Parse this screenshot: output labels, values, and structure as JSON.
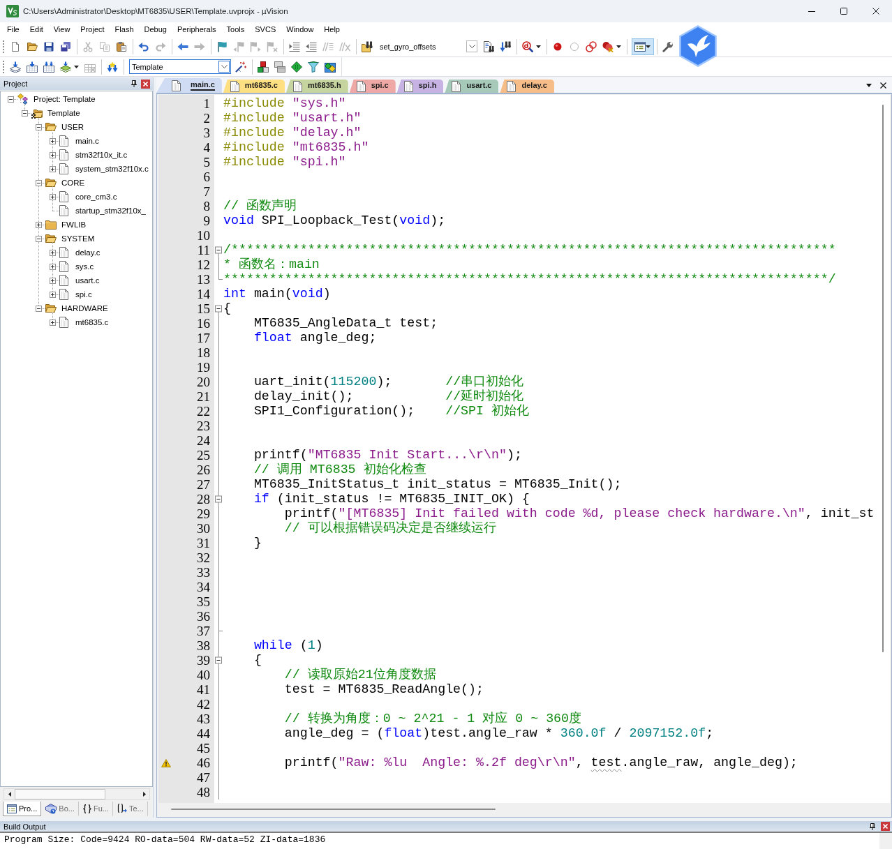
{
  "window": {
    "title": "C:\\Users\\Administrator\\Desktop\\MT6835\\USER\\Template.uvprojx - µVision"
  },
  "menu": [
    "File",
    "Edit",
    "View",
    "Project",
    "Flash",
    "Debug",
    "Peripherals",
    "Tools",
    "SVCS",
    "Window",
    "Help"
  ],
  "toolbar_top": [
    {
      "kind": "new",
      "disabled": false
    },
    {
      "kind": "open",
      "disabled": false
    },
    {
      "kind": "save",
      "disabled": false
    },
    {
      "kind": "saveall",
      "disabled": false
    },
    {
      "kind": "separator"
    },
    {
      "kind": "cut",
      "disabled": true
    },
    {
      "kind": "copy",
      "disabled": true
    },
    {
      "kind": "paste",
      "disabled": false
    },
    {
      "kind": "separator"
    },
    {
      "kind": "undo",
      "disabled": false
    },
    {
      "kind": "redo",
      "disabled": true
    },
    {
      "kind": "separator"
    },
    {
      "kind": "back",
      "disabled": false
    },
    {
      "kind": "forward",
      "disabled": true
    },
    {
      "kind": "separator"
    },
    {
      "kind": "bookmark",
      "disabled": false
    },
    {
      "kind": "prevmark",
      "disabled": true
    },
    {
      "kind": "nextmark",
      "disabled": true
    },
    {
      "kind": "clearmarks",
      "disabled": true
    },
    {
      "kind": "separator"
    },
    {
      "kind": "indent",
      "disabled": false
    },
    {
      "kind": "outdent",
      "disabled": false
    },
    {
      "kind": "comment",
      "disabled": true
    },
    {
      "kind": "uncomment",
      "disabled": true
    },
    {
      "kind": "separator"
    },
    {
      "kind": "findfiles",
      "disabled": false
    },
    {
      "kind": "findcombo",
      "value": "set_gyro_offsets"
    },
    {
      "kind": "find",
      "disabled": false
    },
    {
      "kind": "incfind",
      "disabled": false
    },
    {
      "kind": "separator"
    },
    {
      "kind": "debug",
      "disabled": false,
      "dropdown": true
    },
    {
      "kind": "separator"
    },
    {
      "kind": "breakpoint",
      "disabled": false
    },
    {
      "kind": "enablebp",
      "disabled": true
    },
    {
      "kind": "disablebps",
      "disabled": false
    },
    {
      "kind": "killbps",
      "disabled": false,
      "dropdown": true
    },
    {
      "kind": "separator"
    },
    {
      "kind": "windows",
      "disabled": false,
      "dropdown": true,
      "pressed": true
    },
    {
      "kind": "separator"
    },
    {
      "kind": "configure",
      "disabled": false
    }
  ],
  "toolbar_build": [
    {
      "kind": "translate",
      "disabled": false
    },
    {
      "kind": "build",
      "disabled": false
    },
    {
      "kind": "rebuild",
      "disabled": false
    },
    {
      "kind": "batch",
      "disabled": false,
      "dropdown": true
    },
    {
      "kind": "stop",
      "disabled": true
    },
    {
      "kind": "separator"
    },
    {
      "kind": "download",
      "disabled": false
    },
    {
      "kind": "separator"
    },
    {
      "kind": "targetcombo",
      "value": "Template"
    },
    {
      "kind": "options",
      "disabled": false
    },
    {
      "kind": "separator"
    },
    {
      "kind": "components",
      "disabled": false
    },
    {
      "kind": "environment",
      "disabled": false
    },
    {
      "kind": "packs",
      "disabled": false
    },
    {
      "kind": "selectpacks",
      "disabled": false
    },
    {
      "kind": "installer",
      "disabled": false
    }
  ],
  "project_panel": {
    "title": "Project",
    "tree": [
      {
        "kind": "project",
        "label": "Project: Template",
        "expanded": true,
        "children": [
          {
            "kind": "target",
            "label": "Template",
            "expanded": true,
            "children": [
              {
                "kind": "folder",
                "label": "USER",
                "expanded": true,
                "children": [
                  {
                    "kind": "file",
                    "label": "main.c",
                    "expanded": false
                  },
                  {
                    "kind": "file",
                    "label": "stm32f10x_it.c",
                    "expanded": false
                  },
                  {
                    "kind": "file",
                    "label": "system_stm32f10x.c",
                    "expanded": false
                  }
                ]
              },
              {
                "kind": "folder",
                "label": "CORE",
                "expanded": true,
                "children": [
                  {
                    "kind": "file",
                    "label": "core_cm3.c",
                    "expanded": false
                  },
                  {
                    "kind": "file",
                    "label": "startup_stm32f10x_"
                  }
                ]
              },
              {
                "kind": "folder",
                "label": "FWLIB",
                "expanded": false
              },
              {
                "kind": "folder",
                "label": "SYSTEM",
                "expanded": true,
                "children": [
                  {
                    "kind": "file",
                    "label": "delay.c",
                    "expanded": false
                  },
                  {
                    "kind": "file",
                    "label": "sys.c",
                    "expanded": false
                  },
                  {
                    "kind": "file",
                    "label": "usart.c",
                    "expanded": false
                  },
                  {
                    "kind": "file",
                    "label": "spi.c",
                    "expanded": false
                  }
                ]
              },
              {
                "kind": "folder",
                "label": "HARDWARE",
                "expanded": true,
                "children": [
                  {
                    "kind": "file",
                    "label": "mt6835.c",
                    "expanded": false
                  }
                ]
              }
            ]
          }
        ]
      }
    ],
    "tabs": [
      {
        "kind": "project",
        "label": "Pro...",
        "selected": true
      },
      {
        "kind": "books",
        "label": "Bo...",
        "selected": false
      },
      {
        "kind": "functions",
        "label": "Fu...",
        "selected": false
      },
      {
        "kind": "templates",
        "label": "Te...",
        "selected": false
      }
    ]
  },
  "editor": {
    "tabs": [
      {
        "label": "main.c",
        "color": "#cfdcf3",
        "selected": true
      },
      {
        "label": "mt6835.c",
        "color": "#fedf82",
        "selected": false
      },
      {
        "label": "mt6835.h",
        "color": "#c6d49f",
        "selected": false
      },
      {
        "label": "spi.c",
        "color": "#eea9a6",
        "selected": false
      },
      {
        "label": "spi.h",
        "color": "#c6b3e3",
        "selected": false
      },
      {
        "label": "usart.c",
        "color": "#a6c9ba",
        "selected": false
      },
      {
        "label": "delay.c",
        "color": "#f7bd88",
        "selected": false
      }
    ],
    "lines": [
      {
        "number": "1",
        "kind": "plain",
        "tokens": [
          {
            "kind": "preproc",
            "text": "#include "
          },
          {
            "kind": "string",
            "text": "\"sys.h\""
          }
        ]
      },
      {
        "number": "2",
        "kind": "plain",
        "tokens": [
          {
            "kind": "preproc",
            "text": "#include "
          },
          {
            "kind": "string",
            "text": "\"usart.h\""
          }
        ]
      },
      {
        "number": "3",
        "kind": "plain",
        "tokens": [
          {
            "kind": "preproc",
            "text": "#include "
          },
          {
            "kind": "string",
            "text": "\"delay.h\""
          }
        ]
      },
      {
        "number": "4",
        "kind": "plain",
        "tokens": [
          {
            "kind": "preproc",
            "text": "#include "
          },
          {
            "kind": "string",
            "text": "\"mt6835.h\""
          }
        ]
      },
      {
        "number": "5",
        "kind": "plain",
        "tokens": [
          {
            "kind": "preproc",
            "text": "#include "
          },
          {
            "kind": "string",
            "text": "\"spi.h\""
          }
        ]
      },
      {
        "number": "6",
        "kind": "plain"
      },
      {
        "number": "7",
        "kind": "plain"
      },
      {
        "number": "8",
        "kind": "plain",
        "tokens": [
          {
            "kind": "comment",
            "text": "// 函数声明"
          }
        ]
      },
      {
        "number": "9",
        "kind": "plain",
        "tokens": [
          {
            "kind": "keyword",
            "text": "void"
          },
          {
            "kind": "plain",
            "text": " SPI_Loopback_Test("
          },
          {
            "kind": "keyword",
            "text": "void"
          },
          {
            "kind": "plain",
            "text": ");"
          }
        ]
      },
      {
        "number": "10",
        "kind": "plain"
      },
      {
        "number": "11",
        "kind": "foldstart",
        "tokens": [
          {
            "kind": "comment",
            "text": "/*******************************************************************************"
          }
        ]
      },
      {
        "number": "12",
        "kind": "foldbody",
        "tokens": [
          {
            "kind": "comment",
            "text": "* 函数名：main"
          }
        ]
      },
      {
        "number": "13",
        "kind": "foldend",
        "tokens": [
          {
            "kind": "comment",
            "text": "*******************************************************************************/"
          }
        ]
      },
      {
        "number": "14",
        "kind": "plain",
        "tokens": [
          {
            "kind": "keyword",
            "text": "int"
          },
          {
            "kind": "plain",
            "text": " main("
          },
          {
            "kind": "keyword",
            "text": "void"
          },
          {
            "kind": "plain",
            "text": ")"
          }
        ]
      },
      {
        "number": "15",
        "kind": "foldstart",
        "tokens": [
          {
            "kind": "plain",
            "text": "{"
          }
        ]
      },
      {
        "number": "16",
        "kind": "foldbody",
        "tokens": [
          {
            "kind": "plain",
            "text": "    MT6835_AngleData_t test;"
          }
        ]
      },
      {
        "number": "17",
        "kind": "foldbody",
        "tokens": [
          {
            "kind": "keyword",
            "text": "    float"
          },
          {
            "kind": "plain",
            "text": " angle_deg;"
          }
        ]
      },
      {
        "number": "18",
        "kind": "foldbody"
      },
      {
        "number": "19",
        "kind": "foldbody"
      },
      {
        "number": "20",
        "kind": "foldbody",
        "tokens": [
          {
            "kind": "plain",
            "text": "    uart_init("
          },
          {
            "kind": "number",
            "text": "115200"
          },
          {
            "kind": "plain",
            "text": ");       "
          },
          {
            "kind": "comment",
            "text": "//串口初始化"
          }
        ]
      },
      {
        "number": "21",
        "kind": "foldbody",
        "tokens": [
          {
            "kind": "plain",
            "text": "    delay_init();            "
          },
          {
            "kind": "comment",
            "text": "//延时初始化"
          }
        ]
      },
      {
        "number": "22",
        "kind": "foldbody",
        "tokens": [
          {
            "kind": "plain",
            "text": "    SPI1_Configuration();    "
          },
          {
            "kind": "comment",
            "text": "//SPI 初始化"
          }
        ]
      },
      {
        "number": "23",
        "kind": "foldbody"
      },
      {
        "number": "24",
        "kind": "foldbody"
      },
      {
        "number": "25",
        "kind": "foldbody",
        "tokens": [
          {
            "kind": "plain",
            "text": "    printf("
          },
          {
            "kind": "string",
            "text": "\"MT6835 Init Start...\\r\\n\""
          },
          {
            "kind": "plain",
            "text": ");"
          }
        ]
      },
      {
        "number": "26",
        "kind": "foldbody",
        "tokens": [
          {
            "kind": "comment",
            "text": "    // 调用 MT6835 初始化检查"
          }
        ]
      },
      {
        "number": "27",
        "kind": "foldbody",
        "tokens": [
          {
            "kind": "plain",
            "text": "    MT6835_InitStatus_t init_status = MT6835_Init();"
          }
        ]
      },
      {
        "number": "28",
        "kind": "foldstart",
        "tokens": [
          {
            "kind": "keyword",
            "text": "    if"
          },
          {
            "kind": "plain",
            "text": " (init_status != MT6835_INIT_OK) {"
          }
        ]
      },
      {
        "number": "29",
        "kind": "foldbody",
        "tokens": [
          {
            "kind": "plain",
            "text": "        printf("
          },
          {
            "kind": "string",
            "text": "\"[MT6835] Init failed with code %d, please check hardware.\\n\""
          },
          {
            "kind": "plain",
            "text": ", init_st"
          }
        ]
      },
      {
        "number": "30",
        "kind": "foldbody",
        "tokens": [
          {
            "kind": "comment",
            "text": "        // 可以根据错误码决定是否继续运行"
          }
        ]
      },
      {
        "number": "31",
        "kind": "foldbody",
        "tokens": [
          {
            "kind": "plain",
            "text": "    }"
          }
        ]
      },
      {
        "number": "32",
        "kind": "foldbody"
      },
      {
        "number": "33",
        "kind": "foldbody"
      },
      {
        "number": "34",
        "kind": "foldbody"
      },
      {
        "number": "35",
        "kind": "foldbody"
      },
      {
        "number": "36",
        "kind": "foldbody"
      },
      {
        "number": "37",
        "kind": "foldend"
      },
      {
        "number": "38",
        "kind": "foldbody",
        "tokens": [
          {
            "kind": "keyword",
            "text": "    while"
          },
          {
            "kind": "plain",
            "text": " ("
          },
          {
            "kind": "number",
            "text": "1"
          },
          {
            "kind": "plain",
            "text": ")"
          }
        ]
      },
      {
        "number": "39",
        "kind": "foldstart",
        "tokens": [
          {
            "kind": "plain",
            "text": "    {"
          }
        ]
      },
      {
        "number": "40",
        "kind": "foldbody",
        "tokens": [
          {
            "kind": "comment",
            "text": "        // 读取原始21位角度数据"
          }
        ]
      },
      {
        "number": "41",
        "kind": "foldbody",
        "tokens": [
          {
            "kind": "plain",
            "text": "        test = MT6835_ReadAngle();"
          }
        ]
      },
      {
        "number": "42",
        "kind": "foldbody"
      },
      {
        "number": "43",
        "kind": "foldbody",
        "tokens": [
          {
            "kind": "comment",
            "text": "        // 转换为角度：0 ~ 2^21 - 1 对应 0 ~ 360度"
          }
        ]
      },
      {
        "number": "44",
        "kind": "foldbody",
        "tokens": [
          {
            "kind": "plain",
            "text": "        angle_deg = ("
          },
          {
            "kind": "keyword",
            "text": "float"
          },
          {
            "kind": "plain",
            "text": ")test.angle_raw * "
          },
          {
            "kind": "number",
            "text": "360.0f"
          },
          {
            "kind": "plain",
            "text": " / "
          },
          {
            "kind": "number",
            "text": "2097152.0f"
          },
          {
            "kind": "plain",
            "text": ";"
          }
        ]
      },
      {
        "number": "45",
        "kind": "foldbody"
      },
      {
        "number": "46",
        "kind": "foldbody",
        "warning": true,
        "tokens": [
          {
            "kind": "plain",
            "text": "        printf("
          },
          {
            "kind": "string",
            "text": "\"Raw: %lu  Angle: %.2f deg\\r\\n\""
          },
          {
            "kind": "plain",
            "text": ", "
          },
          {
            "kind": "plain",
            "text": "test",
            "underlined": true
          },
          {
            "kind": "plain",
            "text": ".angle_raw, angle_deg);"
          }
        ]
      },
      {
        "number": "47",
        "kind": "foldbody"
      },
      {
        "number": "48",
        "kind": "foldbody"
      }
    ]
  },
  "build_output": {
    "title": "Build Output",
    "lines": [
      "Program Size: Code=9424 RO-data=504 RW-data=52 ZI-data=1836"
    ]
  }
}
